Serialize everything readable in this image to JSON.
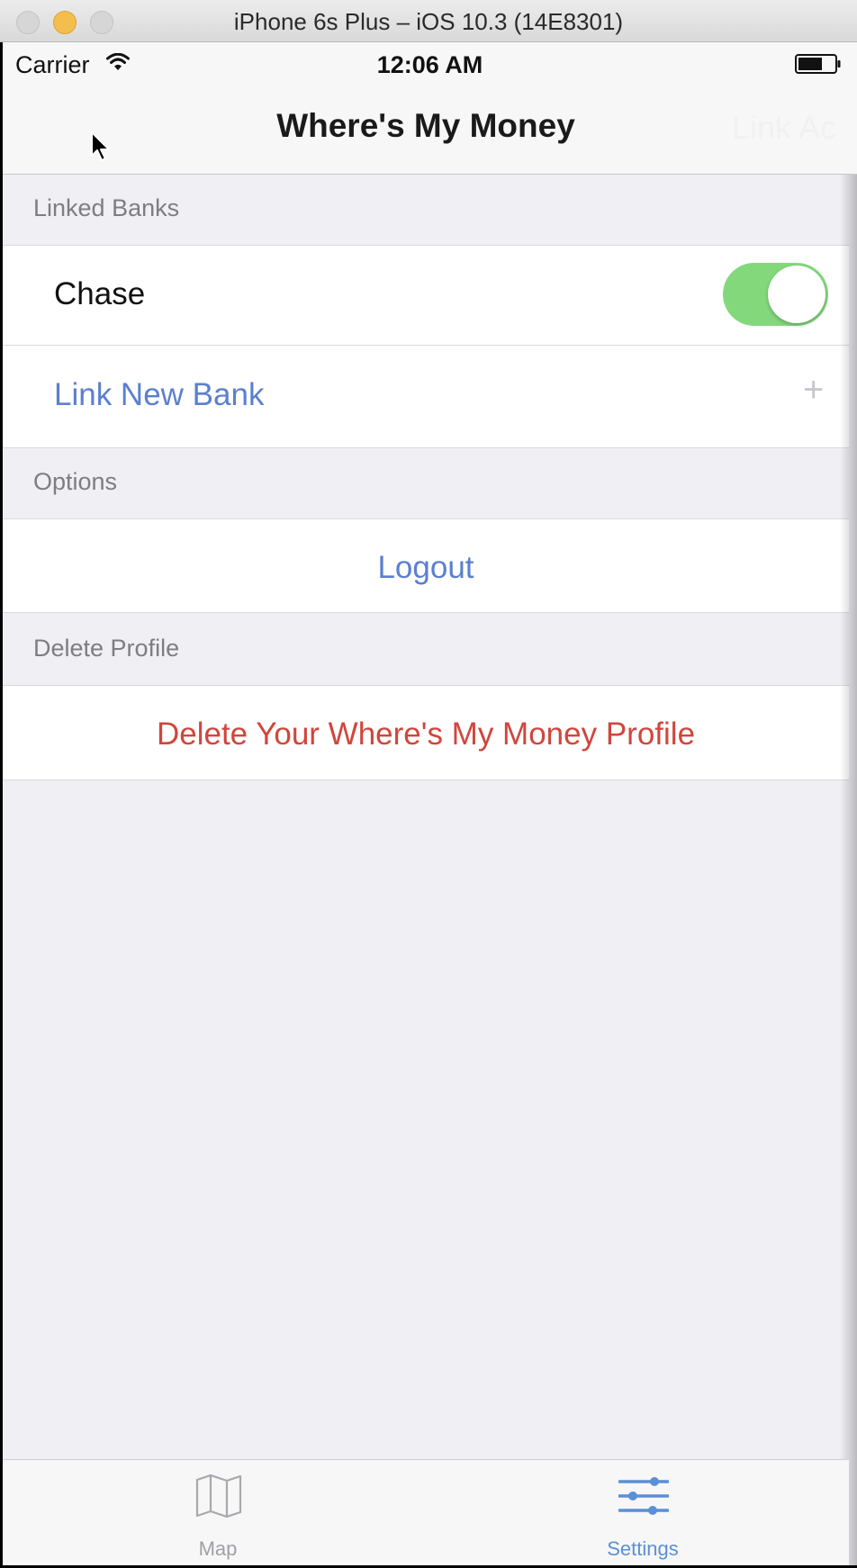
{
  "window": {
    "title": "iPhone 6s Plus – iOS 10.3 (14E8301)"
  },
  "status_bar": {
    "carrier": "Carrier",
    "time": "12:06 AM"
  },
  "nav": {
    "title": "Where's My Money",
    "right_item": "Link Ac"
  },
  "sections": {
    "linked_banks": {
      "header": "Linked Banks",
      "bank_name": "Chase",
      "bank_enabled": true,
      "link_new_label": "Link New Bank",
      "link_new_accessory": "+"
    },
    "options": {
      "header": "Options",
      "logout_label": "Logout"
    },
    "delete_profile": {
      "header": "Delete Profile",
      "delete_label": "Delete Your Where's My Money Profile"
    }
  },
  "tabbar": {
    "items": [
      {
        "label": "Map",
        "icon": "map-icon",
        "selected": false
      },
      {
        "label": "Settings",
        "icon": "sliders-icon",
        "selected": true
      }
    ]
  },
  "colors": {
    "link_blue": "#5b7fd0",
    "destructive_red": "#d0463c",
    "toggle_green": "#84d87c",
    "tab_selected": "#5b8fd6"
  }
}
